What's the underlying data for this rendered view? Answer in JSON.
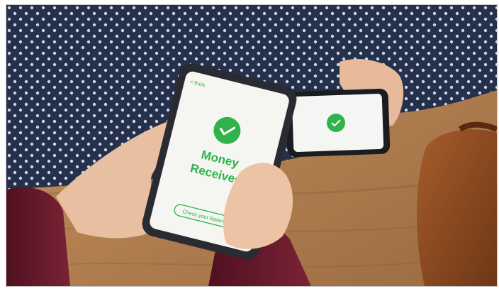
{
  "photo": {
    "phone_main": {
      "back_label": "< Back",
      "headline_line1": "Money",
      "headline_line2": "Received",
      "button_label": "Check your Balance"
    }
  },
  "colors": {
    "accent_green": "#2fb34a",
    "table_wood": "#b98a5c",
    "shirt_navy": "#25304a",
    "sleeve_maroon": "#6d1a2b",
    "bag_brown": "#8a4a22"
  }
}
